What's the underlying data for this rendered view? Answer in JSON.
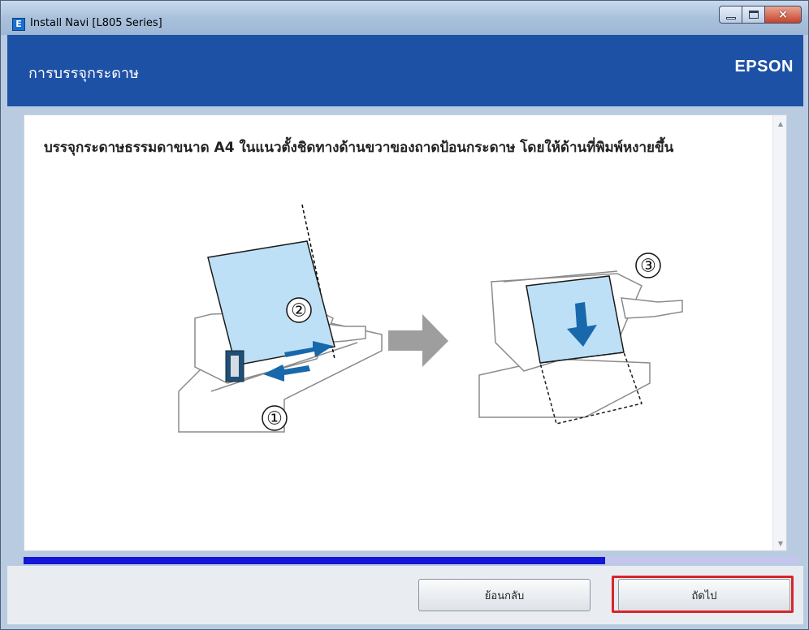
{
  "window": {
    "title": "Install Navi [L805 Series]",
    "app_icon": "E"
  },
  "window_controls": {
    "close_glyph": "×"
  },
  "header": {
    "title": "การบรรจุกระดาษ",
    "brand": "EPSON",
    "color": "#1d51a6"
  },
  "content": {
    "instruction": "บรรจุกระดาษธรรมดาขนาด A4 ในแนวตั้งชิดทางด้านขวาของถาดป้อนกระดาษ โดยให้ด้านที่พิมพ์หงายขึ้น",
    "step_labels": [
      "①",
      "②",
      "③"
    ],
    "arrow_icon": "right-arrow-icon"
  },
  "progress": {
    "value": 0.75,
    "fill_color": "#1616d6",
    "track_color": "#c4c6ee"
  },
  "buttons": {
    "back": "ย้อนกลับ",
    "next": "ถัดไป"
  },
  "highlight_color": "#d8252a"
}
